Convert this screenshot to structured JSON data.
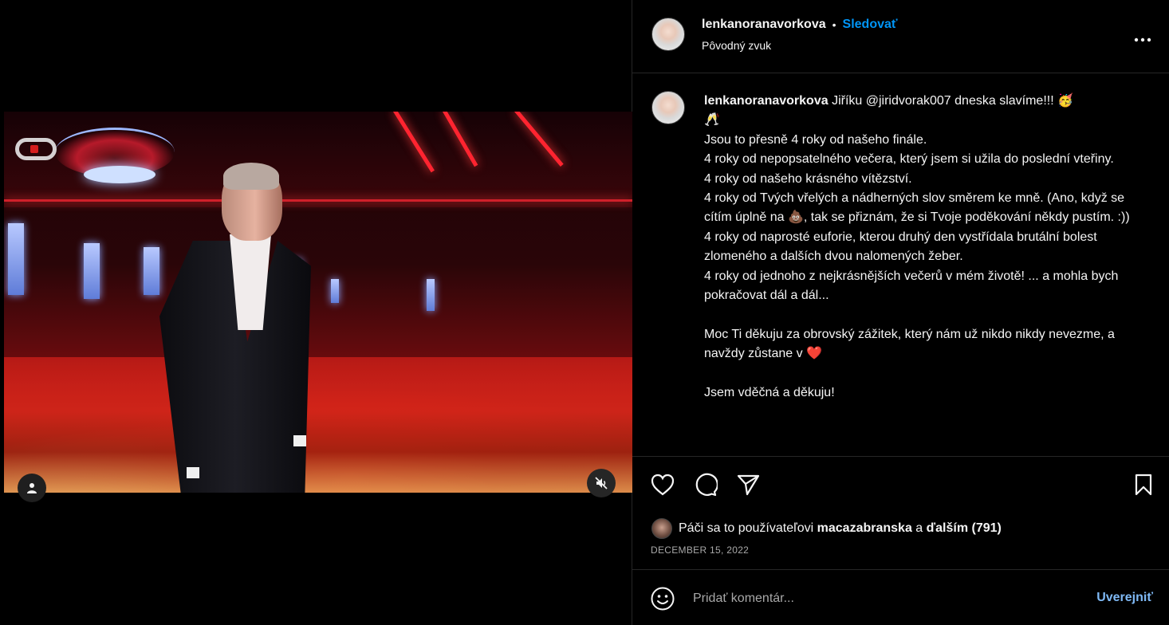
{
  "post": {
    "username": "lenkanoranavorkova",
    "separator": "•",
    "follow_label": "Sledovať",
    "audio_label": "Pôvodný zvuk",
    "more_icon": "more-horizontal-icon"
  },
  "caption": {
    "username": "lenkanoranavorkova",
    "lines": [
      "Jiříku @jiridvorak007 dneska slavíme!!! 🥳",
      "🥂",
      "Jsou to přesně 4 roky od našeho finále.",
      "4 roky od nepopsatelného večera, který jsem si užila do poslední vteřiny.",
      "4 roky od našeho krásného vítězství.",
      "4 roky od Tvých vřelých a nádherných slov směrem ke mně. (Ano, když se cítím úplně na 💩, tak se přiznám, že si Tvoje poděkování někdy pustím. :))",
      "4 roky od naprosté euforie, kterou druhý den vystřídala brutální bolest zlomeného a dalších dvou nalomených žeber.",
      "4 roky od jednoho z nejkrásnějších večerů v mém životě! ... a mohla bych pokračovat dál a dál...",
      "",
      "Moc Ti děkuju za obrovský zážitek, který nám už nikdo nikdy nevezme, a navždy zůstane v ❤️",
      "",
      "Jsem vděčná a děkuju!"
    ]
  },
  "actions": {
    "like_icon": "heart-icon",
    "comment_icon": "comment-icon",
    "share_icon": "send-icon",
    "save_icon": "bookmark-icon"
  },
  "likes": {
    "prefix": "Páči sa to používateľovi",
    "user": "macazabranska",
    "conj": "a",
    "others": "ďalším (791)"
  },
  "date": "DECEMBER 15, 2022",
  "comment": {
    "placeholder": "Pridať komentár...",
    "post_label": "Uverejniť"
  },
  "colors": {
    "accent": "#0095f6",
    "post_disabled": "#7fb9f5",
    "background": "#000000",
    "divider": "#262626"
  }
}
